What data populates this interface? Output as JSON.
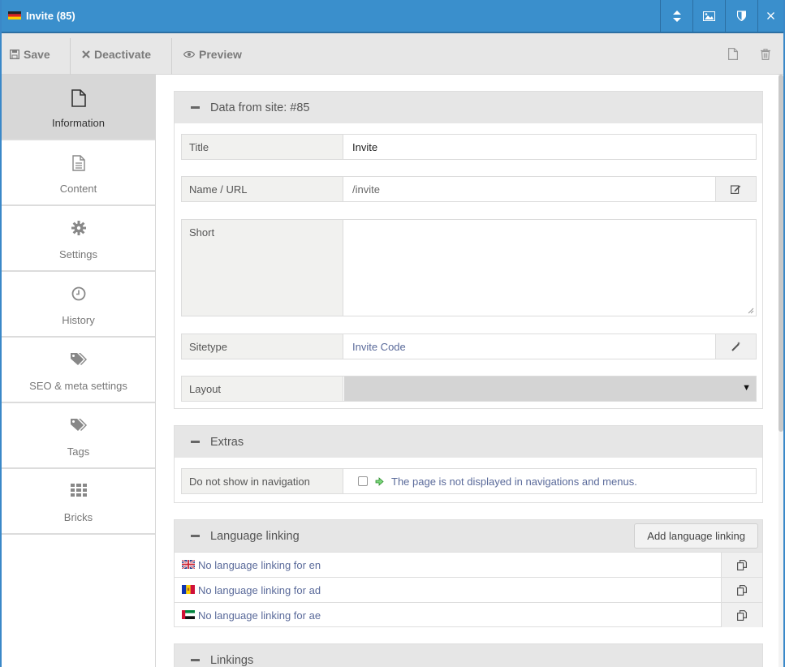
{
  "window": {
    "title": "Invite (85)"
  },
  "toolbar": {
    "save_label": "Save",
    "deactivate_label": "Deactivate",
    "preview_label": "Preview"
  },
  "sidebar": {
    "items": [
      {
        "label": "Information",
        "icon": "file-icon",
        "active": true
      },
      {
        "label": "Content",
        "icon": "document-text-icon"
      },
      {
        "label": "Settings",
        "icon": "gear-icon"
      },
      {
        "label": "History",
        "icon": "clock-icon"
      },
      {
        "label": "SEO & meta settings",
        "icon": "tags-icon"
      },
      {
        "label": "Tags",
        "icon": "tags-icon"
      },
      {
        "label": "Bricks",
        "icon": "grid-icon"
      }
    ]
  },
  "data_panel": {
    "heading": "Data from site: #85",
    "title_label": "Title",
    "title_value": "Invite",
    "name_label": "Name / URL",
    "name_value": "/invite",
    "short_label": "Short",
    "short_value": "",
    "sitetype_label": "Sitetype",
    "sitetype_value": "Invite Code",
    "layout_label": "Layout",
    "layout_value": ""
  },
  "extras_panel": {
    "heading": "Extras",
    "nav_label": "Do not show in navigation",
    "nav_checked": false,
    "nav_hint": "The page is not displayed in navigations and menus."
  },
  "language_panel": {
    "heading": "Language linking",
    "add_button": "Add language linking",
    "rows": [
      {
        "text": "No language linking for en",
        "flag": "uk-flag"
      },
      {
        "text": "No language linking for ad",
        "flag": "andorra-flag"
      },
      {
        "text": "No language linking for ae",
        "flag": "uae-flag"
      }
    ]
  },
  "linkings_panel": {
    "heading": "Linkings"
  },
  "colors": {
    "titlebar": "#3a8fcc",
    "link_text": "#5a6a9a",
    "active_tab": "#d7d7d7"
  }
}
